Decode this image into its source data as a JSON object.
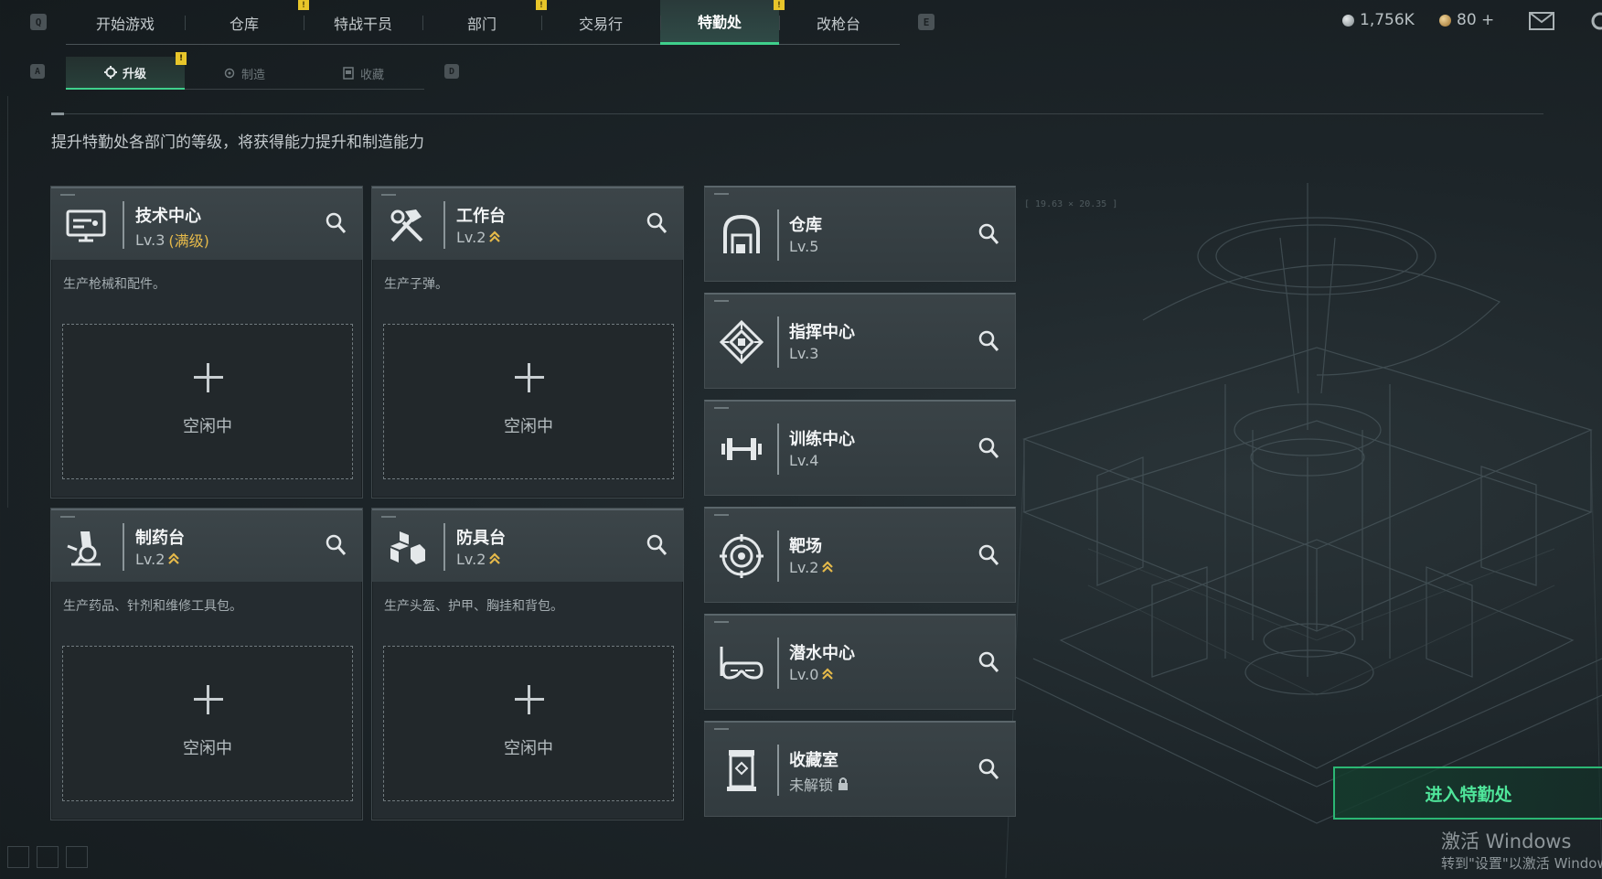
{
  "hotkeys": {
    "left": "Q",
    "right": "E",
    "sub_left": "A",
    "sub_right": "D"
  },
  "nav": {
    "tabs": [
      {
        "label": "开始游戏",
        "active": false,
        "badge": ""
      },
      {
        "label": "仓库",
        "active": false,
        "badge": "!"
      },
      {
        "label": "特战干员",
        "active": false,
        "badge": ""
      },
      {
        "label": "部门",
        "active": false,
        "badge": "!"
      },
      {
        "label": "交易行",
        "active": false,
        "badge": ""
      },
      {
        "label": "特勤处",
        "active": true,
        "badge": "!"
      },
      {
        "label": "改枪台",
        "active": false,
        "badge": ""
      }
    ]
  },
  "currency": {
    "coins": "1,756K",
    "tickets": "80 +"
  },
  "subnav": {
    "tabs": [
      {
        "label": "升级",
        "active": true,
        "badge": "!"
      },
      {
        "label": "制造",
        "active": false
      },
      {
        "label": "收藏",
        "active": false
      }
    ]
  },
  "description": "提升特勤处各部门的等级，将获得能力提升和制造能力",
  "cards": [
    {
      "title": "技术中心",
      "level": "Lv.3",
      "max_label": "(满级)",
      "upgrade": false,
      "desc": "生产枪械和配件。",
      "slot": "空闲中",
      "icon": "computer-icon"
    },
    {
      "title": "工作台",
      "level": "Lv.2",
      "max_label": "",
      "upgrade": true,
      "desc": "生产子弹。",
      "slot": "空闲中",
      "icon": "hammer-wrench-icon"
    },
    {
      "title": "制药台",
      "level": "Lv.2",
      "max_label": "",
      "upgrade": true,
      "desc": "生产药品、针剂和维修工具包。",
      "slot": "空闲中",
      "icon": "microscope-icon"
    },
    {
      "title": "防具台",
      "level": "Lv.2",
      "max_label": "",
      "upgrade": true,
      "desc": "生产头盔、护甲、胸挂和背包。",
      "slot": "空闲中",
      "icon": "cubes-icon"
    }
  ],
  "rows": [
    {
      "title": "仓库",
      "level": "Lv.5",
      "upgrade": false,
      "locked": false,
      "icon": "warehouse-icon"
    },
    {
      "title": "指挥中心",
      "level": "Lv.3",
      "upgrade": false,
      "locked": false,
      "icon": "command-icon"
    },
    {
      "title": "训练中心",
      "level": "Lv.4",
      "upgrade": false,
      "locked": false,
      "icon": "dumbbell-icon"
    },
    {
      "title": "靶场",
      "level": "Lv.2",
      "upgrade": true,
      "locked": false,
      "icon": "target-icon"
    },
    {
      "title": "潜水中心",
      "level": "Lv.0",
      "upgrade": true,
      "locked": false,
      "icon": "diving-mask-icon"
    },
    {
      "title": "收藏室",
      "level": "未解锁",
      "upgrade": false,
      "locked": true,
      "icon": "display-case-icon"
    }
  ],
  "enter_button": "进入特勤处",
  "coord_readout": "[ 19.63 × 20.35 ]",
  "watermark": {
    "line1": "激活 Windows",
    "line2": "转到\"设置\"以激活 Windows。"
  },
  "colors": {
    "accent": "#3fd08c",
    "badge": "#e8c52a",
    "maxed": "#e5b94a"
  }
}
